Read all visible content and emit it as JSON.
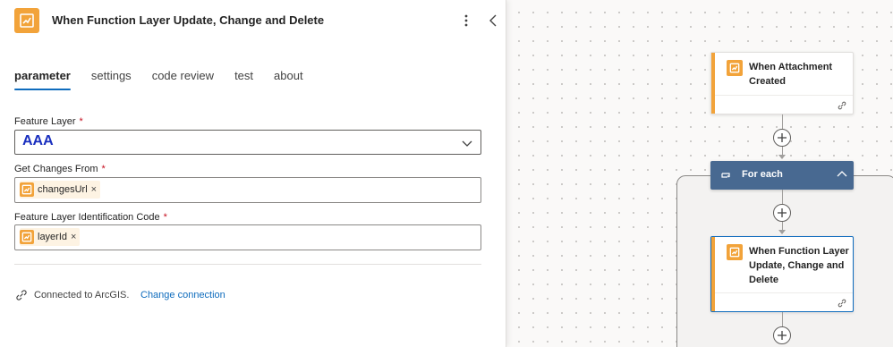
{
  "panel": {
    "title": "When Function Layer Update, Change and Delete",
    "tabs": [
      {
        "label": "parameter",
        "active": true
      },
      {
        "label": "settings",
        "active": false
      },
      {
        "label": "code review",
        "active": false
      },
      {
        "label": "test",
        "active": false
      },
      {
        "label": "about",
        "active": false
      }
    ],
    "fields": {
      "feature_layer": {
        "label": "Feature Layer",
        "required_mark": "*",
        "value": "AAA"
      },
      "get_changes_from": {
        "label": "Get Changes From",
        "required_mark": "*",
        "token": "changesUrl",
        "remove": "×"
      },
      "layer_id_code": {
        "label": "Feature Layer Identification Code",
        "required_mark": "*",
        "token": "layerId",
        "remove": "×"
      }
    },
    "connection": {
      "text": "Connected to ArcGIS.",
      "link": "Change connection"
    }
  },
  "canvas": {
    "trigger_node": {
      "title_line1": "When Attachment",
      "title_line2": "Created"
    },
    "foreach": {
      "label": "For each"
    },
    "inner_node": {
      "title_line1": "When Function Layer",
      "title_line2": "Update, Change and",
      "title_line3": "Delete"
    }
  },
  "colors": {
    "accent": "#0f6cbd",
    "connector_orange": "#f2a33a",
    "foreach_blue": "#486991",
    "selected_value": "#1a2fbf",
    "required": "#c50f1f"
  },
  "icons": [
    "connector-icon",
    "more-vertical-icon",
    "chevron-left-icon",
    "chevron-down-icon",
    "chevron-up-icon",
    "link-icon",
    "plus-icon",
    "loop-icon"
  ]
}
